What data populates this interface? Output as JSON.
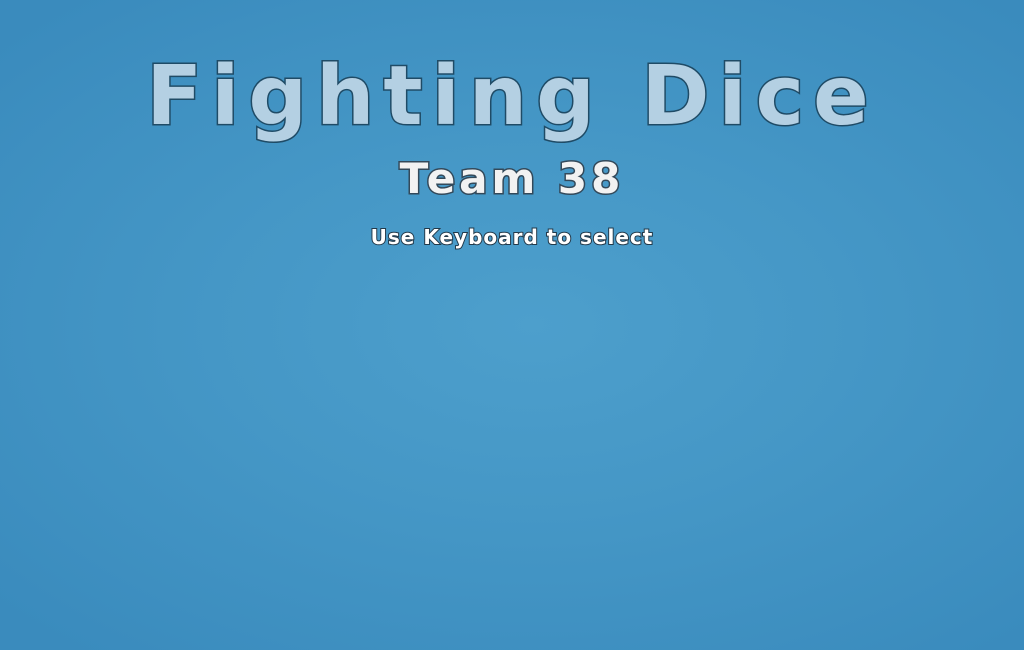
{
  "title_screen": {
    "title": "Fighting Dice",
    "subtitle": "Team 38",
    "instruction": "Use Keyboard to select"
  },
  "colors": {
    "background": "#4597c6",
    "title_fill": "#b4d0e3",
    "title_outline": "#1f4b66",
    "subtitle_fill": "#f2f2f2",
    "instruction_fill": "#ffffff"
  }
}
